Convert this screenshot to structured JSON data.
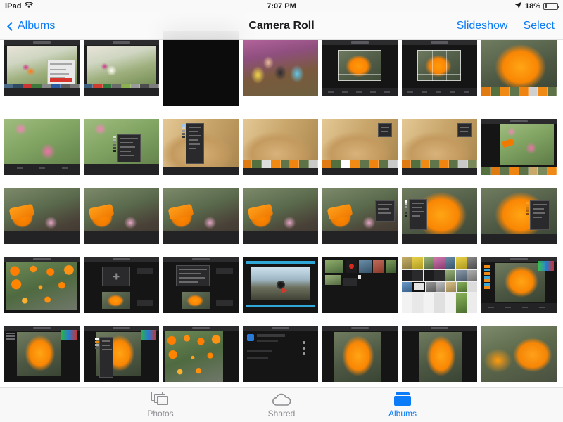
{
  "status_bar": {
    "device": "iPad",
    "wifi_icon": "wifi-icon",
    "time": "7:07 PM",
    "location_icon": "location-arrow-icon",
    "battery_percent": "18%",
    "battery_level": 18,
    "battery_icon": "battery-icon"
  },
  "nav_bar": {
    "back_label": "Albums",
    "back_icon": "chevron-left-icon",
    "title": "Camera Roll",
    "slideshow_label": "Slideshow",
    "select_label": "Select"
  },
  "tab_bar": {
    "tabs": [
      {
        "label": "Photos",
        "icon": "photos-stack-icon",
        "active": false
      },
      {
        "label": "Shared",
        "icon": "cloud-icon",
        "active": false
      },
      {
        "label": "Albums",
        "icon": "albums-folder-icon",
        "active": true
      }
    ]
  },
  "grid": {
    "columns": 7,
    "rows": [
      [
        {
          "name": "photo-edit-app-with-dialog",
          "style": "shot-dialog-light"
        },
        {
          "name": "photo-edit-app-bright-spot",
          "style": "shot-bright-spot"
        },
        {
          "name": "dark-sepia-cat-photo",
          "style": "photo-cat-framed",
          "selected": true,
          "tall": true
        },
        {
          "name": "family-group-photo",
          "style": "photo-family"
        },
        {
          "name": "poppy-crop-editor-a",
          "style": "shot-crop-poppy"
        },
        {
          "name": "poppy-crop-editor-b",
          "style": "shot-crop-poppy"
        },
        {
          "name": "orange-poppy-closeup",
          "style": "photo-poppy-closeup"
        }
      ],
      [
        {
          "name": "green-pink-flower-shot",
          "style": "shot-green-flower"
        },
        {
          "name": "green-pink-flower-panel",
          "style": "shot-green-flower-panel"
        },
        {
          "name": "sepia-grass-panel",
          "style": "shot-sepia-panel"
        },
        {
          "name": "sepia-grass-plain",
          "style": "shot-sepia-plain"
        },
        {
          "name": "sepia-grass-popup-a",
          "style": "shot-sepia-popup"
        },
        {
          "name": "sepia-grass-popup-b",
          "style": "shot-sepia-popup"
        },
        {
          "name": "green-flower-library",
          "style": "shot-green-library"
        }
      ],
      [
        {
          "name": "orange-bud-editor-1",
          "style": "shot-bud"
        },
        {
          "name": "orange-bud-editor-2",
          "style": "shot-bud"
        },
        {
          "name": "orange-bud-editor-3",
          "style": "shot-bud"
        },
        {
          "name": "orange-bud-editor-4",
          "style": "shot-bud"
        },
        {
          "name": "orange-bud-editor-panel",
          "style": "shot-bud-panel"
        },
        {
          "name": "poppy-bloom-editor-left",
          "style": "shot-bloom-left"
        },
        {
          "name": "poppy-bloom-editor-right",
          "style": "shot-bloom-right"
        }
      ],
      [
        {
          "name": "poppy-photo-grid-thumbnails",
          "style": "shot-mosaic"
        },
        {
          "name": "dark-import-dialog-a",
          "style": "shot-import-a"
        },
        {
          "name": "dark-import-dialog-b",
          "style": "shot-import-b"
        },
        {
          "name": "video-editor-landscape",
          "style": "shot-video"
        },
        {
          "name": "media-browser-dark",
          "style": "shot-media-browser"
        },
        {
          "name": "photo-library-grid-light",
          "style": "shot-library-light"
        },
        {
          "name": "poppy-adjust-editor",
          "style": "shot-adjust-poppy"
        }
      ],
      [
        {
          "name": "poppy-editor-histogram-a",
          "style": "shot-histo-poppy"
        },
        {
          "name": "poppy-editor-histogram-b",
          "style": "shot-histo-poppy-panel"
        },
        {
          "name": "poppy-green-grid-shot",
          "style": "shot-poppy-grid"
        },
        {
          "name": "dark-settings-list",
          "style": "shot-settings"
        },
        {
          "name": "poppy-editor-plain-a",
          "style": "shot-poppy-plain"
        },
        {
          "name": "poppy-editor-plain-b",
          "style": "shot-poppy-plain2"
        },
        {
          "name": "poppy-macro-photo",
          "style": "photo-poppy-macro"
        }
      ]
    ]
  }
}
